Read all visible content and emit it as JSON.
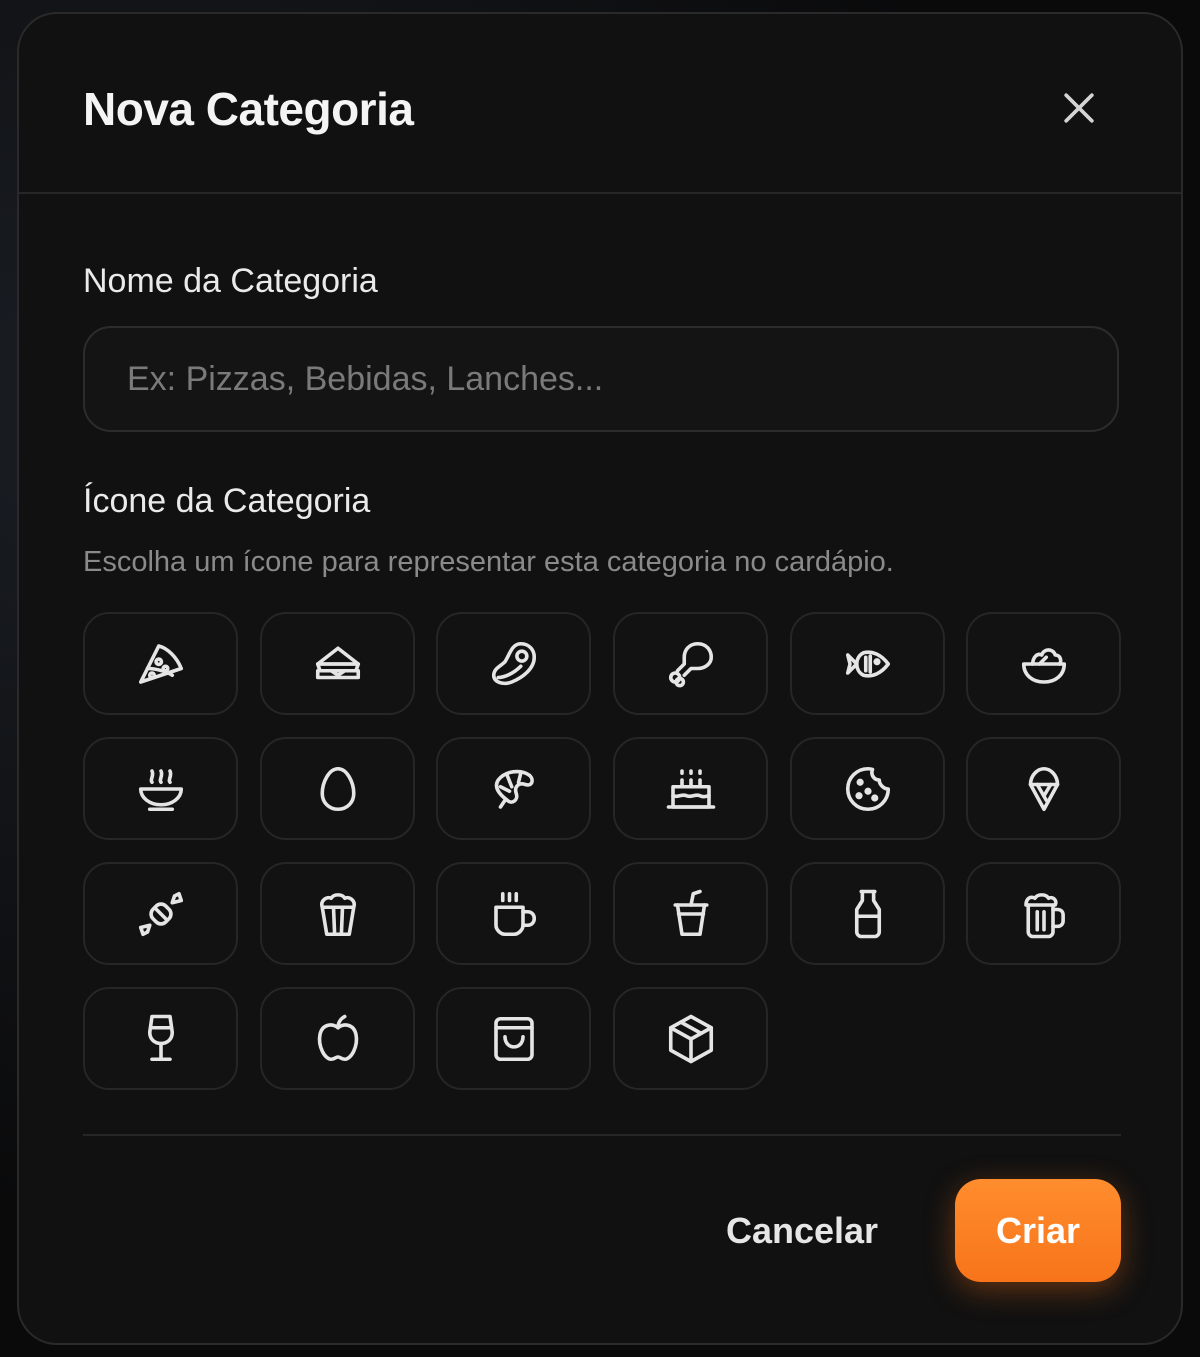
{
  "modal": {
    "title": "Nova Categoria",
    "close_icon": "x-icon"
  },
  "form": {
    "name_label": "Nome da Categoria",
    "name_placeholder": "Ex: Pizzas, Bebidas, Lanches...",
    "name_value": "",
    "icon_label": "Ícone da Categoria",
    "icon_help": "Escolha um ícone para representar esta categoria no cardápio."
  },
  "icons": [
    "pizza-icon",
    "sandwich-icon",
    "steak-icon",
    "drumstick-icon",
    "fish-icon",
    "salad-icon",
    "soup-icon",
    "egg-icon",
    "croissant-icon",
    "cake-icon",
    "cookie-icon",
    "ice-cream-icon",
    "candy-icon",
    "popcorn-icon",
    "coffee-icon",
    "cup-soda-icon",
    "milk-icon",
    "beer-icon",
    "wine-icon",
    "apple-icon",
    "shopping-bag-icon",
    "package-icon"
  ],
  "colors": {
    "accent": "#f97316",
    "icon_stroke": "#e5e5e5",
    "background": "#111111"
  },
  "footer": {
    "cancel_label": "Cancelar",
    "create_label": "Criar"
  }
}
